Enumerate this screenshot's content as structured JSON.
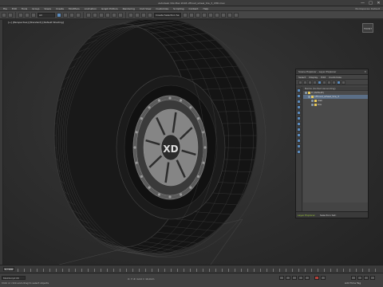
{
  "window": {
    "title": "Autodesk 3ds Max 2018    offroad_wheel_tire_3_XHD.max",
    "controls": [
      "—",
      "□",
      "✕"
    ]
  },
  "menu": {
    "items": [
      "File",
      "Edit",
      "Tools",
      "Group",
      "Views",
      "Create",
      "Modifiers",
      "Animation",
      "Graph Editors",
      "Rendering",
      "Civil View",
      "Customize",
      "Scripting",
      "Content",
      "Help"
    ],
    "workspace": "Workspaces: Default"
  },
  "toolbar": {
    "selection_filter": "All",
    "named_selection": "Create Selection Se"
  },
  "viewport": {
    "label": "[+] [Perspective] [Standard] [Default Shading]",
    "viewcube_label": "FRONT",
    "hub_text": "XD",
    "colors": {
      "tire": "#161616",
      "wire": "#4a4a4a",
      "rim": "#8a8a8a"
    }
  },
  "scene_explorer": {
    "title": "Scene Explorer - Layer Explorer",
    "menu": [
      "Select",
      "Display",
      "Edit",
      "Customize"
    ],
    "column_header": "Name (Sorted Ascending)",
    "rows": [
      {
        "label": "0 (default)",
        "indent": 0,
        "selected": false
      },
      {
        "label": "offroad_wheel_tire_3",
        "indent": 1,
        "selected": true
      },
      {
        "label": "disk",
        "indent": 2,
        "selected": false
      },
      {
        "label": "tire",
        "indent": 2,
        "selected": false
      }
    ],
    "footer_layer": "Layer Explorer",
    "footer_set": "Selection Set:"
  },
  "timeline": {
    "frame": "0 / 100"
  },
  "status": {
    "maxscript": "MAXScript Mi",
    "message": "Click or click-and-drag to select objects",
    "coords": "X:   Y:   Z:   Grid = 10,0cm",
    "autokey": "Add Time Tag"
  }
}
